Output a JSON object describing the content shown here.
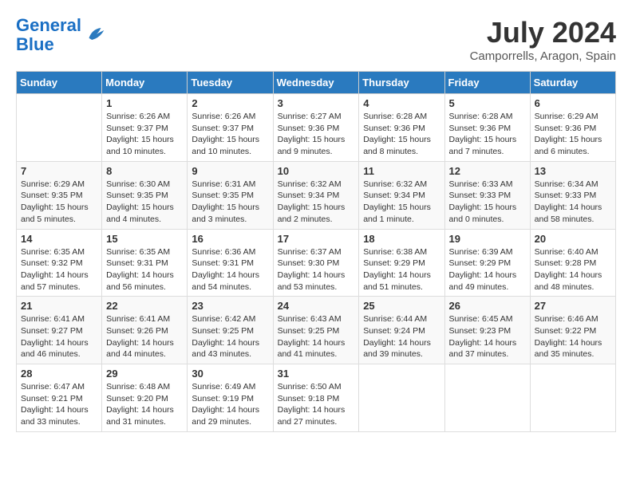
{
  "logo": {
    "text_general": "General",
    "text_blue": "Blue"
  },
  "title": "July 2024",
  "location": "Camporrells, Aragon, Spain",
  "days_of_week": [
    "Sunday",
    "Monday",
    "Tuesday",
    "Wednesday",
    "Thursday",
    "Friday",
    "Saturday"
  ],
  "weeks": [
    [
      {
        "day": "",
        "sunrise": "",
        "sunset": "",
        "daylight": ""
      },
      {
        "day": "1",
        "sunrise": "Sunrise: 6:26 AM",
        "sunset": "Sunset: 9:37 PM",
        "daylight": "Daylight: 15 hours and 10 minutes."
      },
      {
        "day": "2",
        "sunrise": "Sunrise: 6:26 AM",
        "sunset": "Sunset: 9:37 PM",
        "daylight": "Daylight: 15 hours and 10 minutes."
      },
      {
        "day": "3",
        "sunrise": "Sunrise: 6:27 AM",
        "sunset": "Sunset: 9:36 PM",
        "daylight": "Daylight: 15 hours and 9 minutes."
      },
      {
        "day": "4",
        "sunrise": "Sunrise: 6:28 AM",
        "sunset": "Sunset: 9:36 PM",
        "daylight": "Daylight: 15 hours and 8 minutes."
      },
      {
        "day": "5",
        "sunrise": "Sunrise: 6:28 AM",
        "sunset": "Sunset: 9:36 PM",
        "daylight": "Daylight: 15 hours and 7 minutes."
      },
      {
        "day": "6",
        "sunrise": "Sunrise: 6:29 AM",
        "sunset": "Sunset: 9:36 PM",
        "daylight": "Daylight: 15 hours and 6 minutes."
      }
    ],
    [
      {
        "day": "7",
        "sunrise": "Sunrise: 6:29 AM",
        "sunset": "Sunset: 9:35 PM",
        "daylight": "Daylight: 15 hours and 5 minutes."
      },
      {
        "day": "8",
        "sunrise": "Sunrise: 6:30 AM",
        "sunset": "Sunset: 9:35 PM",
        "daylight": "Daylight: 15 hours and 4 minutes."
      },
      {
        "day": "9",
        "sunrise": "Sunrise: 6:31 AM",
        "sunset": "Sunset: 9:35 PM",
        "daylight": "Daylight: 15 hours and 3 minutes."
      },
      {
        "day": "10",
        "sunrise": "Sunrise: 6:32 AM",
        "sunset": "Sunset: 9:34 PM",
        "daylight": "Daylight: 15 hours and 2 minutes."
      },
      {
        "day": "11",
        "sunrise": "Sunrise: 6:32 AM",
        "sunset": "Sunset: 9:34 PM",
        "daylight": "Daylight: 15 hours and 1 minute."
      },
      {
        "day": "12",
        "sunrise": "Sunrise: 6:33 AM",
        "sunset": "Sunset: 9:33 PM",
        "daylight": "Daylight: 15 hours and 0 minutes."
      },
      {
        "day": "13",
        "sunrise": "Sunrise: 6:34 AM",
        "sunset": "Sunset: 9:33 PM",
        "daylight": "Daylight: 14 hours and 58 minutes."
      }
    ],
    [
      {
        "day": "14",
        "sunrise": "Sunrise: 6:35 AM",
        "sunset": "Sunset: 9:32 PM",
        "daylight": "Daylight: 14 hours and 57 minutes."
      },
      {
        "day": "15",
        "sunrise": "Sunrise: 6:35 AM",
        "sunset": "Sunset: 9:31 PM",
        "daylight": "Daylight: 14 hours and 56 minutes."
      },
      {
        "day": "16",
        "sunrise": "Sunrise: 6:36 AM",
        "sunset": "Sunset: 9:31 PM",
        "daylight": "Daylight: 14 hours and 54 minutes."
      },
      {
        "day": "17",
        "sunrise": "Sunrise: 6:37 AM",
        "sunset": "Sunset: 9:30 PM",
        "daylight": "Daylight: 14 hours and 53 minutes."
      },
      {
        "day": "18",
        "sunrise": "Sunrise: 6:38 AM",
        "sunset": "Sunset: 9:29 PM",
        "daylight": "Daylight: 14 hours and 51 minutes."
      },
      {
        "day": "19",
        "sunrise": "Sunrise: 6:39 AM",
        "sunset": "Sunset: 9:29 PM",
        "daylight": "Daylight: 14 hours and 49 minutes."
      },
      {
        "day": "20",
        "sunrise": "Sunrise: 6:40 AM",
        "sunset": "Sunset: 9:28 PM",
        "daylight": "Daylight: 14 hours and 48 minutes."
      }
    ],
    [
      {
        "day": "21",
        "sunrise": "Sunrise: 6:41 AM",
        "sunset": "Sunset: 9:27 PM",
        "daylight": "Daylight: 14 hours and 46 minutes."
      },
      {
        "day": "22",
        "sunrise": "Sunrise: 6:41 AM",
        "sunset": "Sunset: 9:26 PM",
        "daylight": "Daylight: 14 hours and 44 minutes."
      },
      {
        "day": "23",
        "sunrise": "Sunrise: 6:42 AM",
        "sunset": "Sunset: 9:25 PM",
        "daylight": "Daylight: 14 hours and 43 minutes."
      },
      {
        "day": "24",
        "sunrise": "Sunrise: 6:43 AM",
        "sunset": "Sunset: 9:25 PM",
        "daylight": "Daylight: 14 hours and 41 minutes."
      },
      {
        "day": "25",
        "sunrise": "Sunrise: 6:44 AM",
        "sunset": "Sunset: 9:24 PM",
        "daylight": "Daylight: 14 hours and 39 minutes."
      },
      {
        "day": "26",
        "sunrise": "Sunrise: 6:45 AM",
        "sunset": "Sunset: 9:23 PM",
        "daylight": "Daylight: 14 hours and 37 minutes."
      },
      {
        "day": "27",
        "sunrise": "Sunrise: 6:46 AM",
        "sunset": "Sunset: 9:22 PM",
        "daylight": "Daylight: 14 hours and 35 minutes."
      }
    ],
    [
      {
        "day": "28",
        "sunrise": "Sunrise: 6:47 AM",
        "sunset": "Sunset: 9:21 PM",
        "daylight": "Daylight: 14 hours and 33 minutes."
      },
      {
        "day": "29",
        "sunrise": "Sunrise: 6:48 AM",
        "sunset": "Sunset: 9:20 PM",
        "daylight": "Daylight: 14 hours and 31 minutes."
      },
      {
        "day": "30",
        "sunrise": "Sunrise: 6:49 AM",
        "sunset": "Sunset: 9:19 PM",
        "daylight": "Daylight: 14 hours and 29 minutes."
      },
      {
        "day": "31",
        "sunrise": "Sunrise: 6:50 AM",
        "sunset": "Sunset: 9:18 PM",
        "daylight": "Daylight: 14 hours and 27 minutes."
      },
      {
        "day": "",
        "sunrise": "",
        "sunset": "",
        "daylight": ""
      },
      {
        "day": "",
        "sunrise": "",
        "sunset": "",
        "daylight": ""
      },
      {
        "day": "",
        "sunrise": "",
        "sunset": "",
        "daylight": ""
      }
    ]
  ]
}
